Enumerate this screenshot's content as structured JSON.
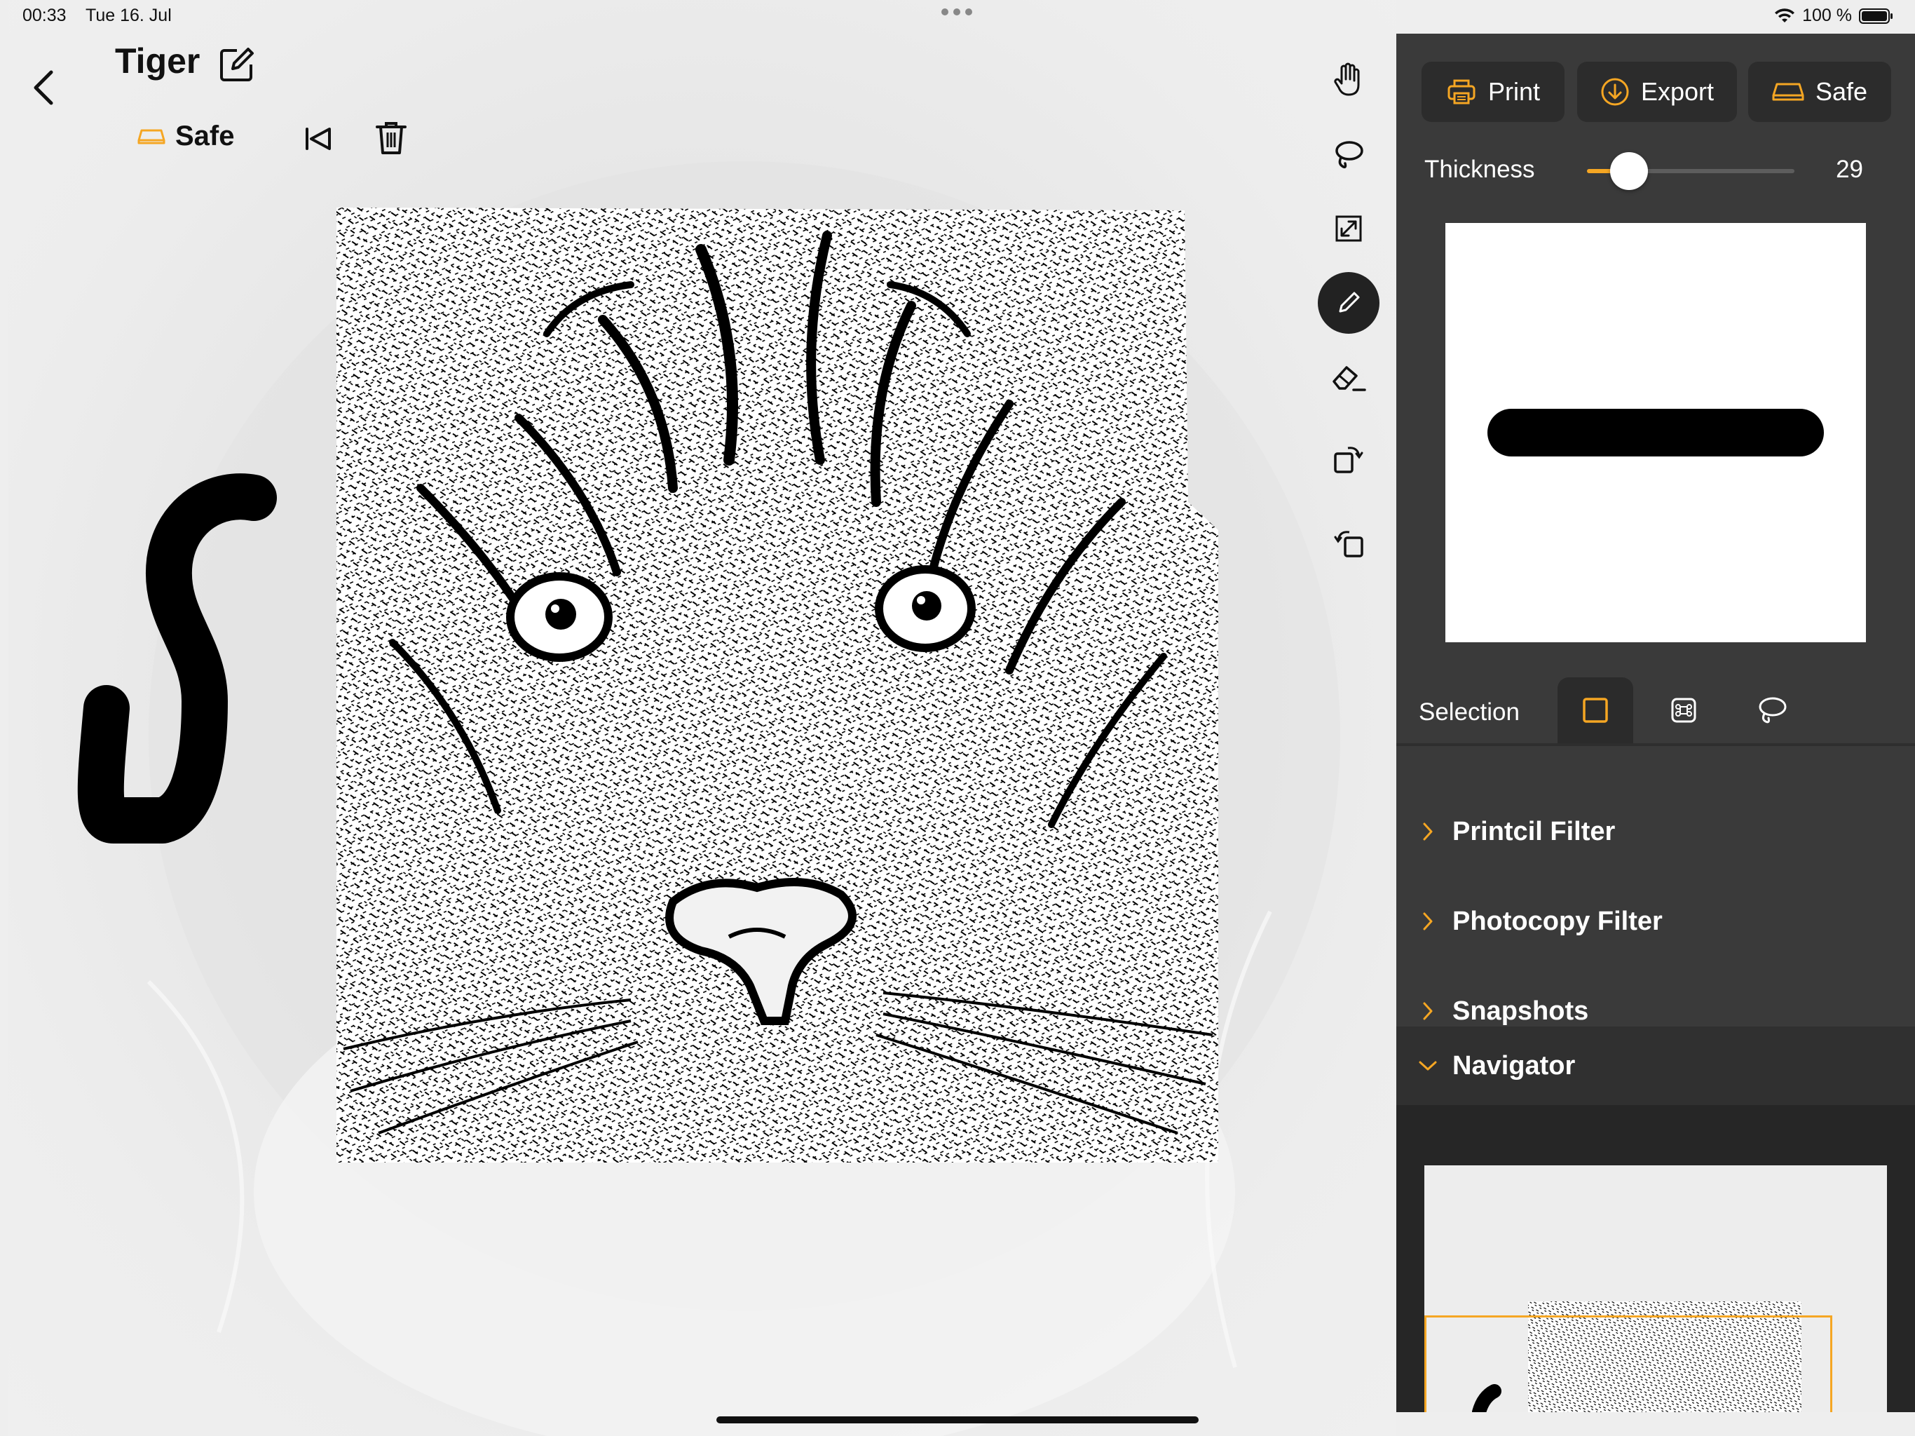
{
  "status_bar": {
    "time": "00:33",
    "date": "Tue 16. Jul",
    "battery": "100 %"
  },
  "header": {
    "title": "Tiger",
    "save_status": "Safe"
  },
  "tools": [
    {
      "name": "hand-icon",
      "active": false
    },
    {
      "name": "lasso-icon",
      "active": false
    },
    {
      "name": "resize-icon",
      "active": false
    },
    {
      "name": "pencil-icon",
      "active": true
    },
    {
      "name": "eraser-icon",
      "active": false
    },
    {
      "name": "rotate-right-icon",
      "active": false
    },
    {
      "name": "rotate-left-icon",
      "active": false
    }
  ],
  "panel": {
    "buttons": {
      "print": "Print",
      "export": "Export",
      "safe": "Safe"
    },
    "thickness": {
      "label": "Thickness",
      "value": "29",
      "fraction": 0.12
    },
    "selection": {
      "label": "Selection",
      "active_mode": "rectangle"
    },
    "sections": [
      {
        "label": "Printcil Filter",
        "expanded": false
      },
      {
        "label": "Photocopy Filter",
        "expanded": false
      },
      {
        "label": "Snapshots",
        "expanded": false
      },
      {
        "label": "Navigator",
        "expanded": true
      }
    ]
  },
  "colors": {
    "accent": "#f5a623",
    "panel_bg": "#3a3a3a",
    "button_bg": "#2c2c2c"
  }
}
